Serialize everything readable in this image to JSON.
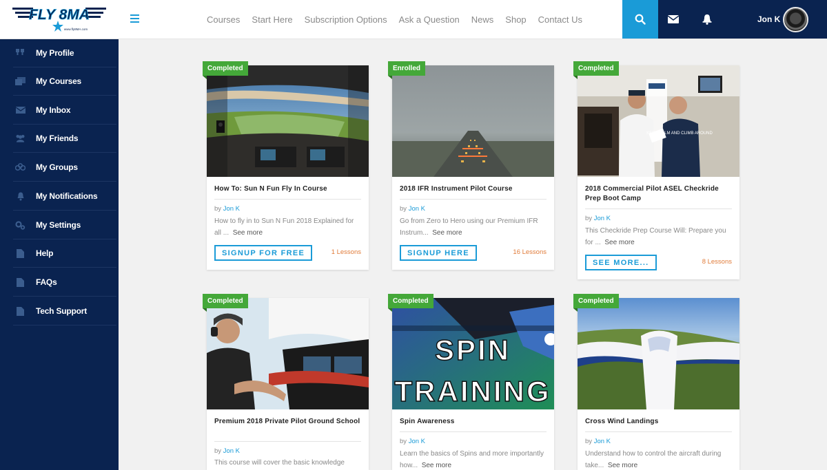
{
  "header": {
    "nav": [
      "Courses",
      "Start Here",
      "Subscription Options",
      "Ask a Question",
      "News",
      "Shop",
      "Contact Us"
    ],
    "user_name": "Jon K",
    "logo_text": "FLY 8MA",
    "logo_sub": "www.fly8MA.com"
  },
  "sidebar": {
    "items": [
      {
        "label": "My Profile",
        "icon": "profile-icon"
      },
      {
        "label": "My Courses",
        "icon": "courses-icon"
      },
      {
        "label": "My Inbox",
        "icon": "inbox-icon"
      },
      {
        "label": "My Friends",
        "icon": "friends-icon"
      },
      {
        "label": "My Groups",
        "icon": "groups-icon"
      },
      {
        "label": "My Notifications",
        "icon": "notifications-icon"
      },
      {
        "label": "My Settings",
        "icon": "settings-icon"
      },
      {
        "label": "Help",
        "icon": "document-icon"
      },
      {
        "label": "FAQs",
        "icon": "document-icon"
      },
      {
        "label": "Tech Support",
        "icon": "document-icon"
      }
    ]
  },
  "courses": [
    {
      "badge": "Completed",
      "title": "How To: Sun N Fun Fly In Course",
      "by": "by",
      "author": "Jon K",
      "desc": "How to fly in to Sun N Fun 2018 Explained for all ...",
      "see_more": "See more",
      "cta": "SIGNUP FOR FREE",
      "lessons": "1 Lessons"
    },
    {
      "badge": "Enrolled",
      "title": "2018 IFR Instrument Pilot Course",
      "by": "by",
      "author": "Jon K",
      "desc": "Go from Zero to Hero using our Premium IFR Instrum...",
      "see_more": "See more",
      "cta": "SIGNUP HERE",
      "lessons": "16 Lessons"
    },
    {
      "badge": "Completed",
      "title": "2018 Commercial Pilot ASEL Checkride Prep Boot Camp",
      "by": "by",
      "author": "Jon K",
      "desc": "This Checkride Prep Course Will: Prepare you for ...",
      "see_more": "See more",
      "cta": "SEE MORE...",
      "lessons": "8 Lessons",
      "photo_text": "KEEP CALM AND CLIMB AROUND"
    },
    {
      "badge": "Completed",
      "title": "Premium 2018 Private Pilot Ground School",
      "by": "by",
      "author": "Jon K",
      "desc": "This course will cover the basic knowledge"
    },
    {
      "badge": "Completed",
      "title": "Spin Awareness",
      "by": "by",
      "author": "Jon K",
      "desc": "Learn the basics of Spins and more importantly how...",
      "see_more": "See more",
      "thumb_text_1": "SPIN",
      "thumb_text_2": "TRAINING"
    },
    {
      "badge": "Completed",
      "title": "Cross Wind Landings",
      "by": "by",
      "author": "Jon K",
      "desc": "Understand how to control the aircraft during take...",
      "see_more": "See more"
    }
  ],
  "colors": {
    "navy": "#0a2350",
    "accent": "#1a9bd7",
    "badge_green": "#44a839",
    "lessons_orange": "#e07b39"
  }
}
